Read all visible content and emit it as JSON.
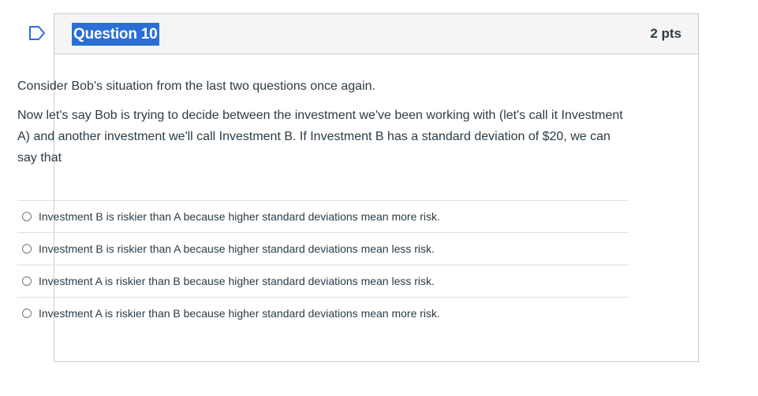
{
  "question": {
    "title": "Question 10",
    "points": "2 pts",
    "paragraphs": [
      "Consider Bob's situation from the last two questions once again.",
      "Now let's say Bob is trying to decide between the investment we've been working with (let's call it Investment A) and another investment we'll call Investment B.  If Investment B has a standard deviation of $20, we can say that"
    ]
  },
  "answers": [
    {
      "label": "Investment B is riskier than A because higher standard deviations mean more risk."
    },
    {
      "label": "Investment B is riskier than A because higher standard deviations mean less risk."
    },
    {
      "label": "Investment A is riskier than B because higher standard deviations mean less risk."
    },
    {
      "label": "Investment A is riskier than B because higher standard deviations mean more risk."
    }
  ],
  "icons": {
    "flag": "flag-question-icon"
  },
  "colors": {
    "accent": "#2b6fd6",
    "flag": "#2b6fd6",
    "text": "#2d3b45",
    "border": "#c7cdd1",
    "header_bg": "#f5f5f5"
  }
}
